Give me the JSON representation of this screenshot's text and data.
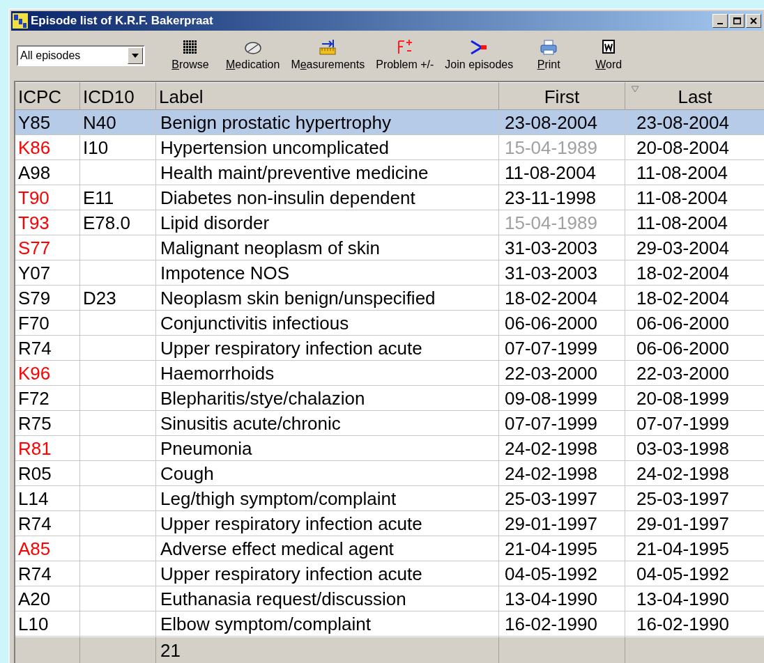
{
  "window": {
    "title": "Episode list of K.R.F. Bakerpraat"
  },
  "filter": {
    "value": "All episodes"
  },
  "toolbar": [
    {
      "kind": "browse",
      "accel": "B",
      "label_rest": "rowse"
    },
    {
      "kind": "medication",
      "accel": "M",
      "label_rest": "edication"
    },
    {
      "kind": "measurements",
      "label_start": "M",
      "accel": "e",
      "label_rest": "asurements"
    },
    {
      "kind": "problem",
      "label_rest": "Problem +/-"
    },
    {
      "kind": "join",
      "label_rest": "Join episodes"
    },
    {
      "kind": "print",
      "accel": "P",
      "label_rest": "rint"
    },
    {
      "kind": "word",
      "accel": "W",
      "label_rest": "ord"
    }
  ],
  "table": {
    "columns": [
      {
        "label": "ICPC",
        "sorted": false
      },
      {
        "label": "ICD10",
        "sorted": false
      },
      {
        "label": "Label",
        "sorted": false
      },
      {
        "label": "First",
        "sorted": false
      },
      {
        "label": "Last",
        "sorted": true
      }
    ],
    "rows": [
      {
        "icpc": "Y85",
        "color": "#000000",
        "icd10": "N40",
        "label": "Benign prostatic hypertrophy",
        "first": "23-08-2004",
        "first_dimmed": false,
        "last": "23-08-2004",
        "selected": true
      },
      {
        "icpc": "K86",
        "color": "#ff0000",
        "icd10": "I10",
        "label": "Hypertension uncomplicated",
        "first": "15-04-1989",
        "first_dimmed": true,
        "last": "20-08-2004",
        "selected": false
      },
      {
        "icpc": "A98",
        "color": "#000000",
        "label": "Health maint/preventive medicine",
        "first": "11-08-2004",
        "first_dimmed": false,
        "last": "11-08-2004",
        "selected": false
      },
      {
        "icpc": "T90",
        "color": "#ff0000",
        "icd10": "E11",
        "label": "Diabetes non-insulin dependent",
        "first": "23-11-1998",
        "first_dimmed": false,
        "last": "11-08-2004",
        "selected": false
      },
      {
        "icpc": "T93",
        "color": "#ff0000",
        "icd10": "E78.0",
        "label": "Lipid disorder",
        "first": "15-04-1989",
        "first_dimmed": true,
        "last": "11-08-2004",
        "selected": false
      },
      {
        "icpc": "S77",
        "color": "#ff0000",
        "label": "Malignant neoplasm of skin",
        "first": "31-03-2003",
        "first_dimmed": false,
        "last": "29-03-2004",
        "selected": false
      },
      {
        "icpc": "Y07",
        "color": "#000000",
        "label": "Impotence NOS",
        "first": "31-03-2003",
        "first_dimmed": false,
        "last": "18-02-2004",
        "selected": false
      },
      {
        "icpc": "S79",
        "color": "#000000",
        "icd10": "D23",
        "label": "Neoplasm skin benign/unspecified",
        "first": "18-02-2004",
        "first_dimmed": false,
        "last": "18-02-2004",
        "selected": false
      },
      {
        "icpc": "F70",
        "color": "#000000",
        "label": "Conjunctivitis infectious",
        "first": "06-06-2000",
        "first_dimmed": false,
        "last": "06-06-2000",
        "selected": false
      },
      {
        "icpc": "R74",
        "color": "#000000",
        "label": "Upper respiratory infection acute",
        "first": "07-07-1999",
        "first_dimmed": false,
        "last": "06-06-2000",
        "selected": false
      },
      {
        "icpc": "K96",
        "color": "#ff0000",
        "label": "Haemorrhoids",
        "first": "22-03-2000",
        "first_dimmed": false,
        "last": "22-03-2000",
        "selected": false
      },
      {
        "icpc": "F72",
        "color": "#000000",
        "label": "Blepharitis/stye/chalazion",
        "first": "09-08-1999",
        "first_dimmed": false,
        "last": "20-08-1999",
        "selected": false
      },
      {
        "icpc": "R75",
        "color": "#000000",
        "label": "Sinusitis acute/chronic",
        "first": "07-07-1999",
        "first_dimmed": false,
        "last": "07-07-1999",
        "selected": false
      },
      {
        "icpc": "R81",
        "color": "#ff0000",
        "label": "Pneumonia",
        "first": "24-02-1998",
        "first_dimmed": false,
        "last": "03-03-1998",
        "selected": false
      },
      {
        "icpc": "R05",
        "color": "#000000",
        "label": "Cough",
        "first": "24-02-1998",
        "first_dimmed": false,
        "last": "24-02-1998",
        "selected": false
      },
      {
        "icpc": "L14",
        "color": "#000000",
        "label": "Leg/thigh symptom/complaint",
        "first": "25-03-1997",
        "first_dimmed": false,
        "last": "25-03-1997",
        "selected": false
      },
      {
        "icpc": "R74",
        "color": "#000000",
        "label": "Upper respiratory infection acute",
        "first": "29-01-1997",
        "first_dimmed": false,
        "last": "29-01-1997",
        "selected": false
      },
      {
        "icpc": "A85",
        "color": "#ff0000",
        "label": "Adverse effect medical agent",
        "first": "21-04-1995",
        "first_dimmed": false,
        "last": "21-04-1995",
        "selected": false
      },
      {
        "icpc": "R74",
        "color": "#000000",
        "label": "Upper respiratory infection acute",
        "first": "04-05-1992",
        "first_dimmed": false,
        "last": "04-05-1992",
        "selected": false
      },
      {
        "icpc": "A20",
        "color": "#000000",
        "label": "Euthanasia request/discussion",
        "first": "13-04-1990",
        "first_dimmed": false,
        "last": "13-04-1990",
        "selected": false
      },
      {
        "icpc": "L10",
        "color": "#000000",
        "label": "Elbow symptom/complaint",
        "first": "16-02-1990",
        "first_dimmed": false,
        "last": "16-02-1990",
        "selected": false
      }
    ],
    "footer": {
      "count": "21"
    }
  }
}
